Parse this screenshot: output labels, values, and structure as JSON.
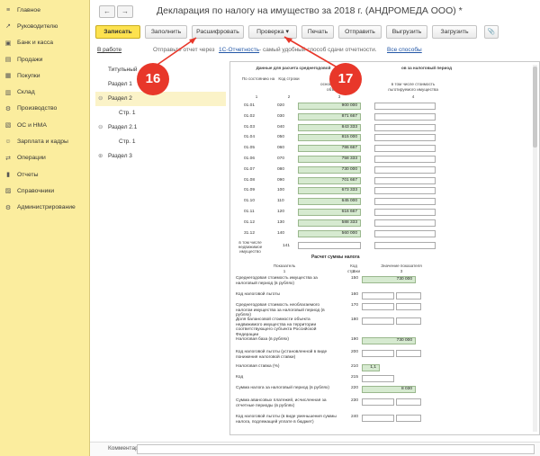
{
  "sidebar": {
    "items": [
      {
        "label": "Главное",
        "icon": "≡"
      },
      {
        "label": "Руководителю",
        "icon": "↗"
      },
      {
        "label": "Банк и касса",
        "icon": "▣"
      },
      {
        "label": "Продажи",
        "icon": "▤"
      },
      {
        "label": "Покупки",
        "icon": "▦"
      },
      {
        "label": "Склад",
        "icon": "▥"
      },
      {
        "label": "Производство",
        "icon": "⚙"
      },
      {
        "label": "ОС и НМА",
        "icon": "▧"
      },
      {
        "label": "Зарплата и кадры",
        "icon": "☺"
      },
      {
        "label": "Операции",
        "icon": "⇄"
      },
      {
        "label": "Отчеты",
        "icon": "▮"
      },
      {
        "label": "Справочники",
        "icon": "▨"
      },
      {
        "label": "Администрирование",
        "icon": "⚙"
      }
    ]
  },
  "title": {
    "text": "Декларация по налогу на имущество за 2018 г. (АНДРОМЕДА ООО) *",
    "back": "←",
    "forward": "→"
  },
  "toolbar": {
    "save": "Записать",
    "fill": "Заполнить",
    "decode": "Расшифровать",
    "check": "Проверка",
    "print": "Печать",
    "send": "Отправить",
    "upload": "Выгрузить",
    "load": "Загрузить",
    "attach": "📎"
  },
  "infobar": {
    "status": "В работе",
    "send_prefix": "Отправьте отчет через",
    "link": "1С-Отчетность",
    "suffix": "- самый удобный способ сдачи отчетности.",
    "all_methods": "Все способы"
  },
  "tree": [
    {
      "label": "Титульный",
      "indent": 0,
      "expander": "",
      "selected": false
    },
    {
      "label": "Раздел 1",
      "indent": 0,
      "expander": "",
      "selected": false
    },
    {
      "label": "Раздел 2",
      "indent": 0,
      "expander": "⊖",
      "selected": true
    },
    {
      "label": "Стр. 1",
      "indent": 1,
      "expander": "",
      "selected": false
    },
    {
      "label": "Раздел 2.1",
      "indent": 0,
      "expander": "⊖",
      "selected": false
    },
    {
      "label": "Стр. 1",
      "indent": 1,
      "expander": "",
      "selected": false
    },
    {
      "label": "Раздел 3",
      "indent": 0,
      "expander": "⊕",
      "selected": false
    }
  ],
  "form": {
    "header": {
      "title": "Данные для расчета среднегодовой",
      "title_cont": "ов за налоговый период",
      "col1": "По состоянию на",
      "col2": "Код строки",
      "col3": "основных средств, объектов не",
      "col4": "в том числе стоимость льготируемого имущества",
      "n1": "1",
      "n2": "2",
      "n3": "3",
      "n4": "4"
    },
    "rows": [
      {
        "date": "01.01",
        "code": "020",
        "value": "900 000"
      },
      {
        "date": "01.02",
        "code": "030",
        "value": "871 667"
      },
      {
        "date": "01.03",
        "code": "040",
        "value": "843 333"
      },
      {
        "date": "01.04",
        "code": "050",
        "value": "815 000"
      },
      {
        "date": "01.05",
        "code": "060",
        "value": "786 667"
      },
      {
        "date": "01.06",
        "code": "070",
        "value": "758 333"
      },
      {
        "date": "01.07",
        "code": "080",
        "value": "730 000"
      },
      {
        "date": "01.08",
        "code": "090",
        "value": "701 667"
      },
      {
        "date": "01.09",
        "code": "100",
        "value": "673 333"
      },
      {
        "date": "01.10",
        "code": "110",
        "value": "645 000"
      },
      {
        "date": "01.11",
        "code": "120",
        "value": "616 667"
      },
      {
        "date": "01.12",
        "code": "130",
        "value": "588 333"
      },
      {
        "date": "31.12",
        "code": "140",
        "value": "560 000"
      }
    ],
    "nedv": {
      "label": "в том числе недвижимое имущество",
      "code": "141"
    },
    "calc_title": "Расчет суммы налога",
    "calc_hdr": {
      "ind": "Показатель",
      "code": "Код строки",
      "val": "Значение показателя",
      "n1": "1",
      "n2": "2",
      "n3": "3"
    },
    "calc": [
      {
        "label": "Среднегодовая стоимость имущества за налоговый период (в рублях)",
        "code": "150",
        "value": "730 000"
      },
      {
        "label": "Код налоговой льготы",
        "code": "160",
        "value": ""
      },
      {
        "label": "Среднегодовая стоимость необлагаемого налогом имущества за налоговый период (в рублях)",
        "code": "170",
        "value": ""
      },
      {
        "label": "Доля балансовой стоимости объекта недвижимого имущества на территории соответствующего субъекта Российской Федерации",
        "code": "180",
        "value": ""
      },
      {
        "label": "Налоговая база (в рублях)",
        "code": "190",
        "value": "730 000"
      },
      {
        "label": "Код налоговой льготы (установленной в виде понижения налоговой ставки)",
        "code": "200",
        "value": ""
      },
      {
        "label": "Налоговая ставка (%)",
        "code": "210",
        "value": "1,1"
      },
      {
        "label": "Код",
        "code": "215",
        "value": ""
      },
      {
        "label": "Сумма налога за налоговый период (в рублях)",
        "code": "220",
        "value": "8 030"
      },
      {
        "label": "Сумма авансовых платежей, исчисленная за отчетные периоды (в рублях)",
        "code": "230",
        "value": ""
      },
      {
        "label": "Код налоговой льготы (в виде уменьшения суммы налога, подлежащей уплате в бюджет)",
        "code": "240",
        "value": ""
      }
    ]
  },
  "markers": {
    "m16": "16",
    "m17": "17"
  },
  "comment": {
    "label": "Комментарий:"
  },
  "colors": {
    "sidebar_bg": "#fbed9e",
    "primary_btn": "#fde24f",
    "marker": "#e8372a",
    "field_green": "#d6ead0",
    "link": "#2256a6"
  }
}
